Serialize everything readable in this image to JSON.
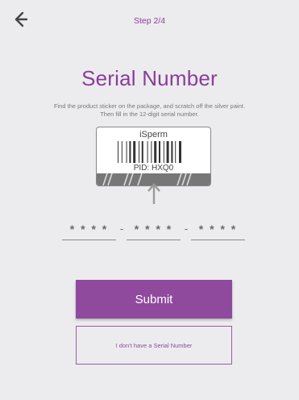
{
  "header": {
    "back_icon": "arrow-left-icon",
    "step_label": "Step 2/4"
  },
  "main": {
    "title": "Serial Number",
    "instructions": "Find the product sticker on the package, and scratch off the silver paint. Then fill in the 12-digit serial number.",
    "sticker": {
      "brand": "iSperm",
      "pid": "PID: HXQ0",
      "arrow_icon": "arrow-up-icon"
    },
    "serial": {
      "part1_placeholder": "* * * *",
      "part2_placeholder": "* * * *",
      "part3_placeholder": "* * * *",
      "separator": "-"
    },
    "submit_label": "Submit",
    "no_serial_label": "I don't have a Serial Number"
  },
  "colors": {
    "accent": "#8f4a9e",
    "background": "#ececee"
  }
}
